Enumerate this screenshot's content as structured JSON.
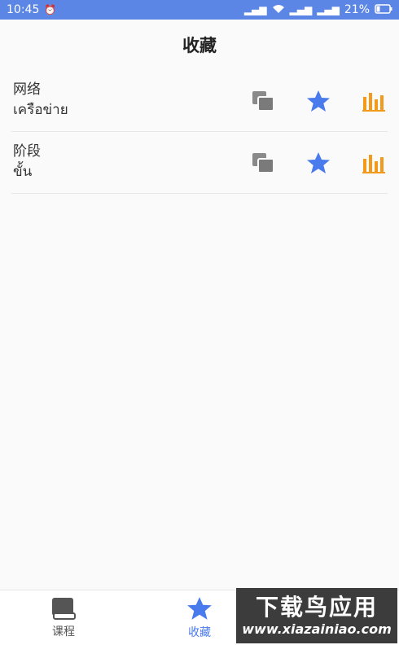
{
  "status_bar": {
    "time": "10:45",
    "battery": "21%"
  },
  "header": {
    "title": "收藏"
  },
  "favorites": [
    {
      "chinese": "网络",
      "thai": "เครือข่าย"
    },
    {
      "chinese": "阶段",
      "thai": "ขั้น"
    }
  ],
  "tabs": {
    "courses": "课程",
    "favorites": "收藏"
  },
  "watermark": {
    "title": "下载鸟应用",
    "url": "www.xiazainiao.com"
  },
  "colors": {
    "accent": "#4a7bec",
    "status_bar": "#5b86e5",
    "stats_orange": "#f29a1b",
    "copy_gray": "#7a7a7a"
  },
  "icons": [
    "alarm-icon",
    "signal-icon",
    "wifi-icon",
    "battery-icon",
    "copy-icon",
    "star-icon",
    "bar-chart-icon",
    "book-icon"
  ]
}
